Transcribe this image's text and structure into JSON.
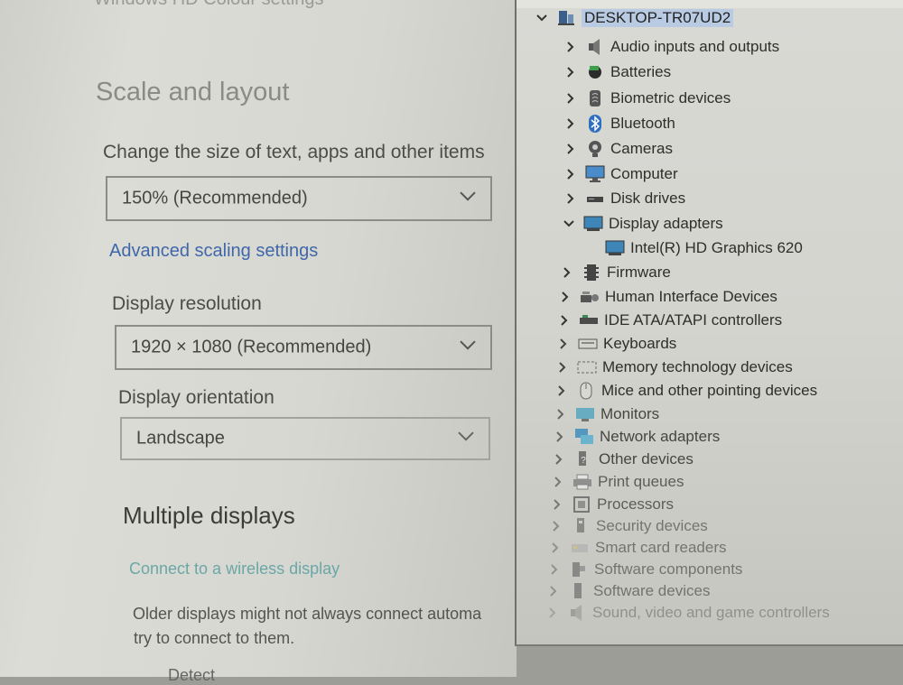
{
  "settings": {
    "cut_title": "Windows HD Colour settings",
    "scale_heading": "Scale and layout",
    "scale_label": "Change the size of text, apps and other items",
    "scale_value": "150% (Recommended)",
    "advanced_link": "Advanced scaling settings",
    "resolution_label": "Display resolution",
    "resolution_value": "1920 × 1080 (Recommended)",
    "orientation_label": "Display orientation",
    "orientation_value": "Landscape",
    "multi_heading": "Multiple displays",
    "wireless_link": "Connect to a wireless display",
    "older_line1": "Older displays might not always connect automa",
    "older_line2": "try to connect to them.",
    "detect_button": "Detect"
  },
  "device_manager": {
    "root": "DESKTOP-TR07UD2",
    "categories": [
      {
        "label": "Audio inputs and outputs",
        "icon": "speaker-icon"
      },
      {
        "label": "Batteries",
        "icon": "battery-icon"
      },
      {
        "label": "Biometric devices",
        "icon": "fingerprint-icon"
      },
      {
        "label": "Bluetooth",
        "icon": "bluetooth-icon"
      },
      {
        "label": "Cameras",
        "icon": "camera-icon"
      },
      {
        "label": "Computer",
        "icon": "computer-icon"
      },
      {
        "label": "Disk drives",
        "icon": "disk-drive-icon"
      },
      {
        "label": "Display adapters",
        "icon": "display-adapter-icon",
        "expanded": true
      },
      {
        "label": "Intel(R) HD Graphics 620",
        "icon": "display-adapter-icon",
        "child": true
      },
      {
        "label": "Firmware",
        "icon": "chip-icon"
      },
      {
        "label": "Human Interface Devices",
        "icon": "hid-icon"
      },
      {
        "label": "IDE ATA/ATAPI controllers",
        "icon": "controller-icon"
      },
      {
        "label": "Keyboards",
        "icon": "keyboard-icon"
      },
      {
        "label": "Memory technology devices",
        "icon": "memory-icon"
      },
      {
        "label": "Mice and other pointing devices",
        "icon": "mouse-icon"
      },
      {
        "label": "Monitors",
        "icon": "monitor-icon"
      },
      {
        "label": "Network adapters",
        "icon": "network-icon"
      },
      {
        "label": "Other devices",
        "icon": "other-devices-icon"
      },
      {
        "label": "Print queues",
        "icon": "printer-icon"
      },
      {
        "label": "Processors",
        "icon": "processor-icon"
      },
      {
        "label": "Security devices",
        "icon": "security-icon"
      },
      {
        "label": "Smart card readers",
        "icon": "smart-card-icon"
      },
      {
        "label": "Software components",
        "icon": "software-component-icon"
      },
      {
        "label": "Software devices",
        "icon": "software-device-icon"
      },
      {
        "label": "Sound, video and game controllers",
        "icon": "sound-icon"
      }
    ]
  },
  "colors": {
    "accent_link": "#3f67a9",
    "selection": "#b9cbe3"
  }
}
